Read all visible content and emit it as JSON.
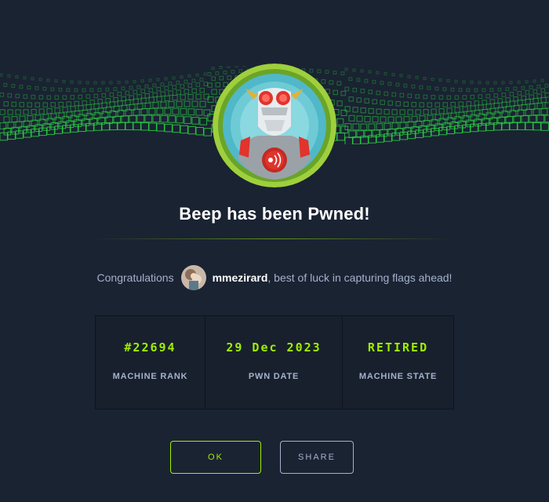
{
  "dialog": {
    "title": "Beep has been Pwned!",
    "congrats_prefix": "Congratulations",
    "username": "mmezirard",
    "congrats_suffix": ", best of luck in capturing flags ahead!"
  },
  "stats": [
    {
      "value": "#22694",
      "label": "MACHINE RANK"
    },
    {
      "value": "29 Dec 2023",
      "label": "PWN DATE"
    },
    {
      "value": "RETIRED",
      "label": "MACHINE STATE"
    }
  ],
  "buttons": {
    "ok_label": "OK",
    "share_label": "SHARE"
  },
  "colors": {
    "background": "#1a2332",
    "accent": "#9fef00",
    "muted_text": "#a4b1cd"
  },
  "icons": {
    "banner": "green-cube-wave-banner",
    "machine_avatar": "robot-machine-avatar",
    "user_avatar": "user-avatar"
  }
}
